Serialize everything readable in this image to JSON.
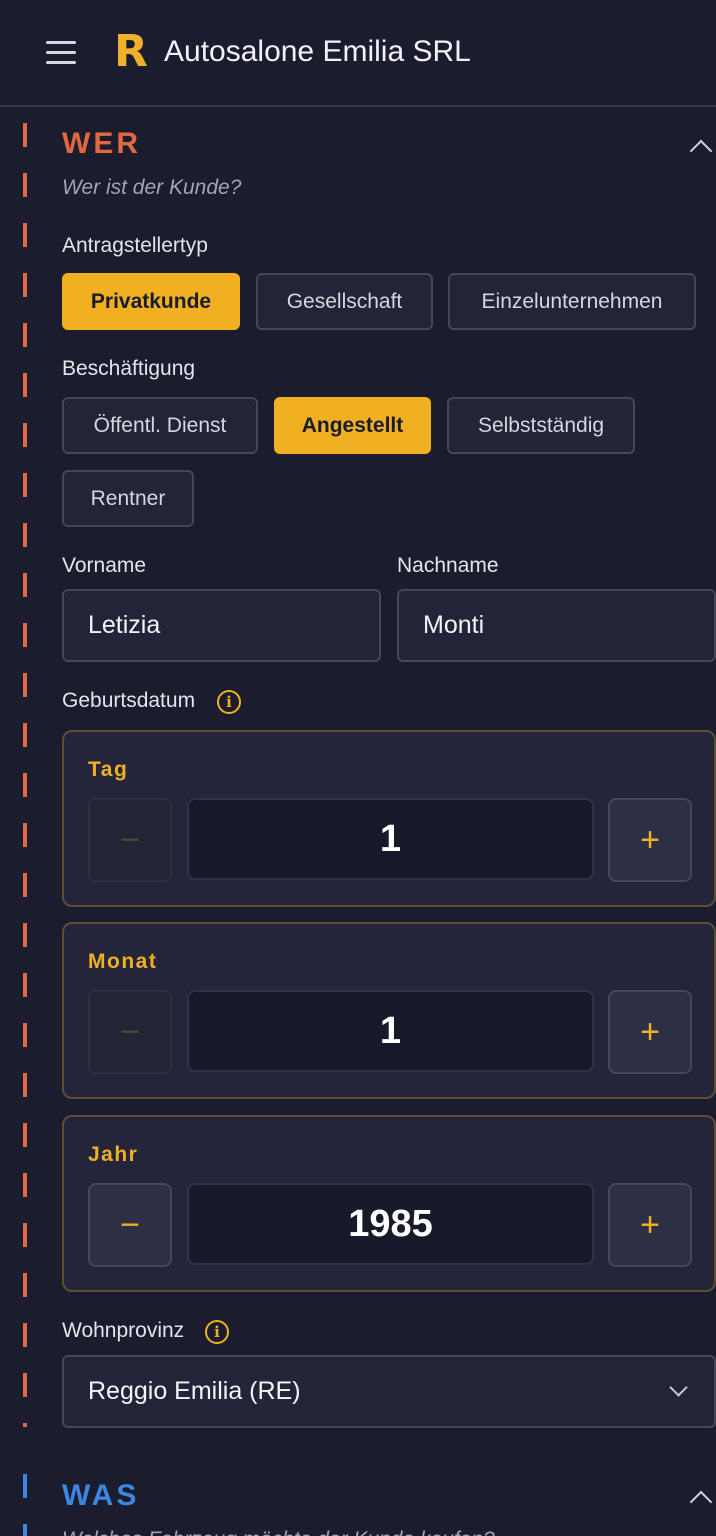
{
  "header": {
    "logo": "R",
    "brand": "Autosalone Emilia SRL",
    "menu_icon": "hamburger-menu-icon"
  },
  "wer": {
    "title": "WER",
    "subtitle": "Wer ist der Kunde?",
    "title_color": "#e26842",
    "applicant_type": {
      "label": "Antragstellertyp",
      "options": [
        "Privatkunde",
        "Gesellschaft",
        "Einzelunternehmen"
      ],
      "selected": "Privatkunde"
    },
    "employment": {
      "label": "Beschäftigung",
      "options": [
        "Öffentl. Dienst",
        "Angestellt",
        "Selbstständig",
        "Rentner"
      ],
      "selected": "Angestellt"
    },
    "first_name": {
      "label": "Vorname",
      "value": "Letizia"
    },
    "last_name": {
      "label": "Nachname",
      "value": "Monti"
    },
    "birthdate": {
      "label": "Geburtsdatum",
      "info_icon": "i",
      "day": {
        "label": "Tag",
        "value": "1",
        "minus": "−",
        "plus": "+"
      },
      "month": {
        "label": "Monat",
        "value": "1",
        "minus": "−",
        "plus": "+"
      },
      "year": {
        "label": "Jahr",
        "value": "1985",
        "minus": "−",
        "plus": "+"
      }
    },
    "province": {
      "label": "Wohnprovinz",
      "info_icon": "i",
      "value": "Reggio Emilia (RE)"
    }
  },
  "was": {
    "title": "WAS",
    "subtitle": "Welches Fahrzeug möchte der Kunde kaufen?",
    "title_color": "#3c86e0"
  },
  "accent": "#f0b021"
}
